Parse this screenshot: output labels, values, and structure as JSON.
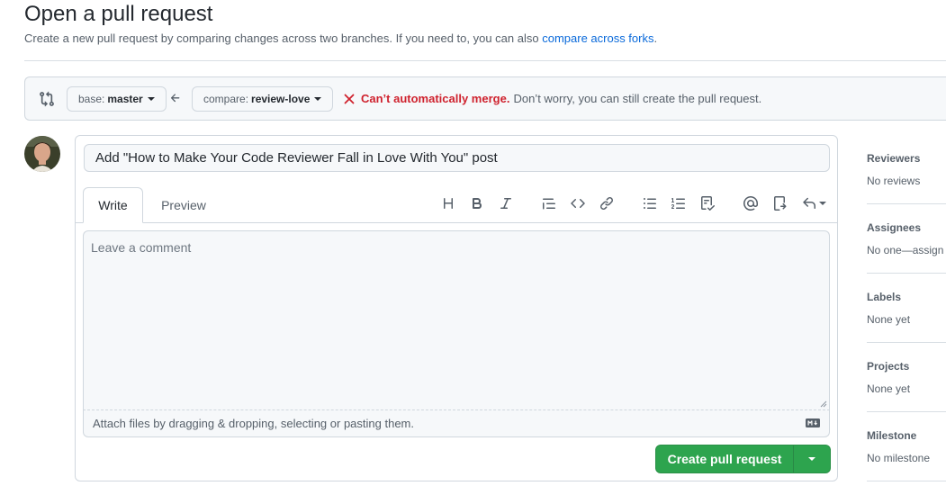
{
  "page": {
    "title": "Open a pull request",
    "subtitle_prefix": "Create a new pull request by comparing changes across two branches. If you need to, you can also ",
    "subtitle_link": "compare across forks",
    "subtitle_suffix": "."
  },
  "compare": {
    "base_label": "base:",
    "base_value": "master",
    "compare_label": "compare:",
    "compare_value": "review-love",
    "merge_error": "Can’t automatically merge.",
    "merge_message": "Don’t worry, you can still create the pull request."
  },
  "editor": {
    "title_value": "Add \"How to Make Your Code Reviewer Fall in Love With You\" post",
    "tabs": [
      {
        "label": "Write"
      },
      {
        "label": "Preview"
      }
    ],
    "toolbar_icons": [
      "heading-icon",
      "bold-icon",
      "italic-icon",
      "quote-icon",
      "code-icon",
      "link-icon",
      "unordered-list-icon",
      "ordered-list-icon",
      "task-list-icon",
      "mention-icon",
      "cross-reference-icon",
      "saved-reply-icon"
    ],
    "comment_placeholder": "Leave a comment",
    "attach_text": "Attach files by dragging & dropping, selecting or pasting them.",
    "create_button": "Create pull request"
  },
  "sidebar": {
    "sections": [
      {
        "heading": "Reviewers",
        "value": "No reviews"
      },
      {
        "heading": "Assignees",
        "value": "No one—assign"
      },
      {
        "heading": "Labels",
        "value": "None yet"
      },
      {
        "heading": "Projects",
        "value": "None yet"
      },
      {
        "heading": "Milestone",
        "value": "No milestone"
      }
    ]
  },
  "colors": {
    "accent_link": "#0969da",
    "error_red": "#cf222e",
    "primary_green": "#2da44e"
  }
}
